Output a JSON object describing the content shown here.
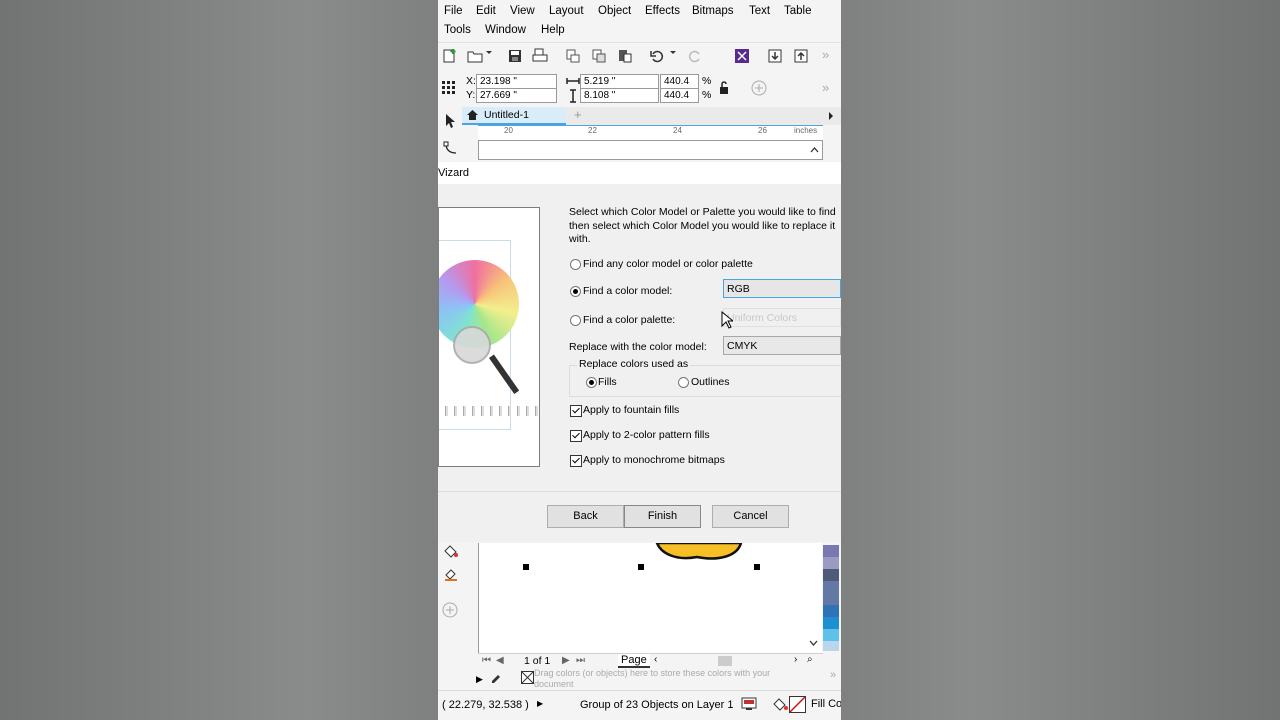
{
  "menu": {
    "row1": [
      "File",
      "Edit",
      "View",
      "Layout",
      "Object",
      "Effects",
      "Bitmaps",
      "Text",
      "Table"
    ],
    "row2": [
      "Tools",
      "Window",
      "Help"
    ]
  },
  "propbar": {
    "x_label": "X:",
    "x_value": "23.198 \"",
    "y_label": "Y:",
    "y_value": "27.669 \"",
    "width_value": "5.219 \"",
    "height_value": "8.108 \"",
    "scale_w": "440.4",
    "scale_h": "440.4",
    "percent": "%"
  },
  "document_tab": {
    "label": "Untitled-1",
    "add": "+"
  },
  "ruler": {
    "ticks": [
      "20",
      "22",
      "24",
      "26"
    ],
    "unit": "inches"
  },
  "dialog": {
    "title": "Vizard",
    "description": "Select which Color Model or Palette you would like to find then select which Color Model you would like to replace it with.",
    "option_any": "Find any color model or color palette",
    "option_model": "Find a color model:",
    "option_palette": "Find a color palette:",
    "model_value": "RGB",
    "palette_value": "Uniform Colors",
    "replace_label": "Replace with the color model:",
    "replace_value": "CMYK",
    "group_title": "Replace colors used as",
    "fills": "Fills",
    "outlines": "Outlines",
    "check_fountain": "Apply to fountain fills",
    "check_pattern": "Apply to 2-color pattern fills",
    "check_mono": "Apply to monochrome bitmaps",
    "back": "Back",
    "finish": "Finish",
    "cancel": "Cancel"
  },
  "navigator": {
    "page_of": "1 of 1",
    "page_tab": "Page",
    "drag_hint": "Drag colors (or objects) here to store these colors with your document"
  },
  "status": {
    "coords": "( 22.279, 32.538 )",
    "selection": "Group of 23 Objects on Layer 1",
    "fill": "Fill Co"
  },
  "colors": {
    "accent": "#4aa3df",
    "palette": [
      "#7a78b0",
      "#9a9bc2",
      "#4e5a78",
      "#6478a6",
      "#2f73b7",
      "#1e8fd0",
      "#5ec1ea",
      "#b9d6ea"
    ]
  }
}
